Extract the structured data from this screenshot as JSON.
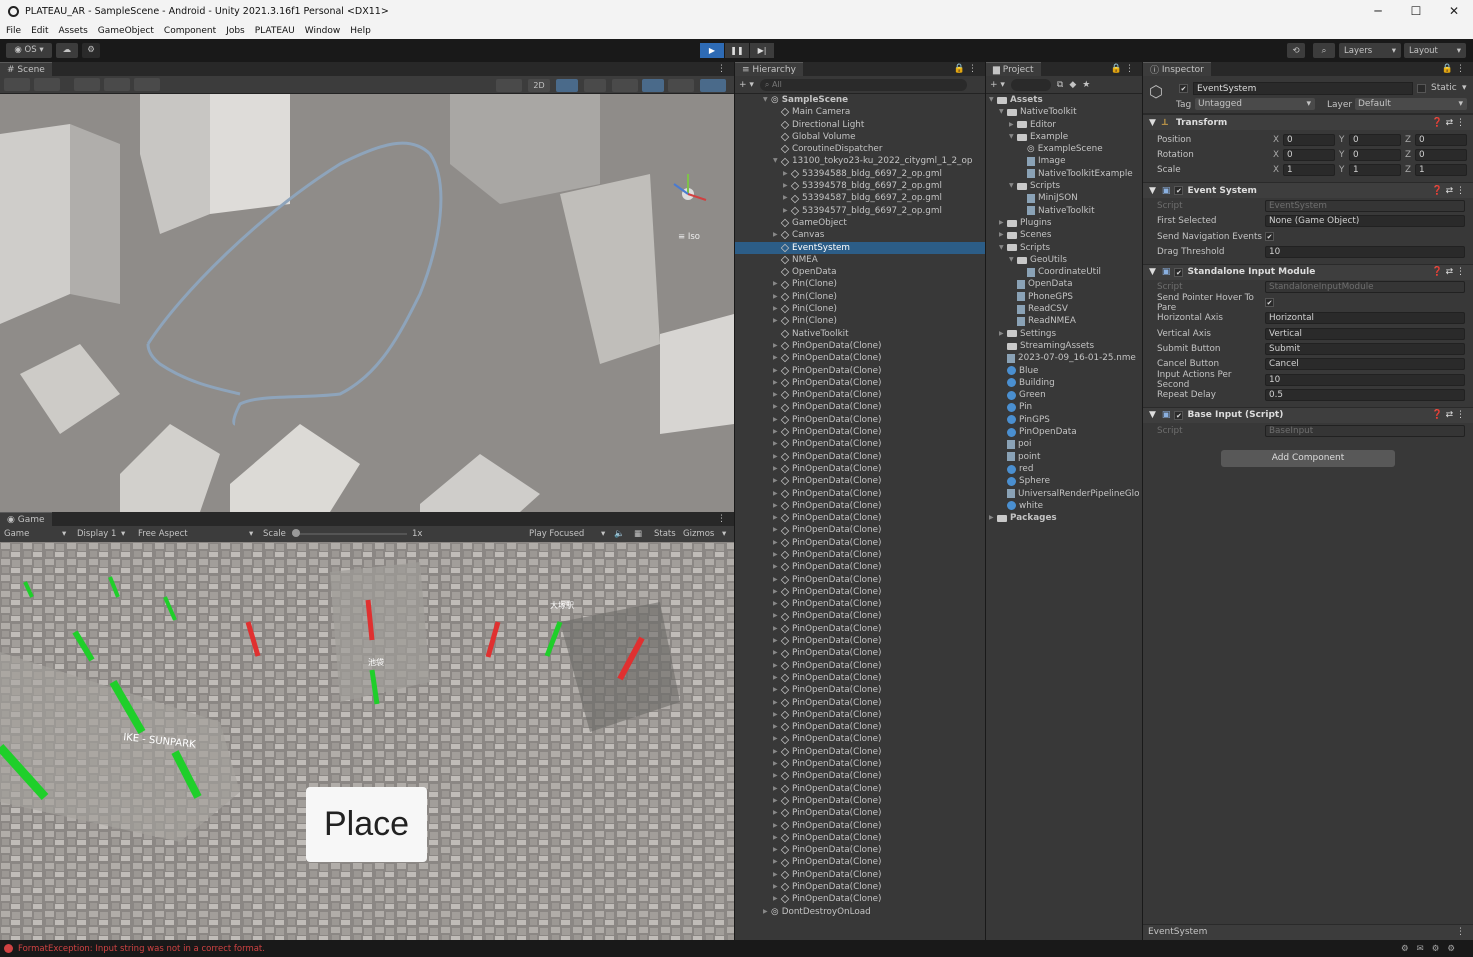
{
  "window": {
    "title": "PLATEAU_AR - SampleScene - Android - Unity 2021.3.16f1 Personal <DX11>",
    "minimize": "─",
    "maximize": "☐",
    "close": "✕"
  },
  "menu": [
    "File",
    "Edit",
    "Assets",
    "GameObject",
    "Component",
    "Jobs",
    "PLATEAU",
    "Window",
    "Help"
  ],
  "toolbar": {
    "account": "OS",
    "layers": "Layers",
    "layout": "Layout"
  },
  "scene": {
    "tab": "Scene",
    "btn2d": "2D",
    "iso": "Iso"
  },
  "game": {
    "tab": "Game",
    "mode": "Game",
    "display": "Display 1",
    "aspect": "Free Aspect",
    "scale_label": "Scale",
    "scale_value": "1x",
    "play_focused": "Play Focused",
    "stats": "Stats",
    "gizmos": "Gizmos",
    "place_button": "Place",
    "place_labels": [
      "IKE - SUNPARK",
      "池袋",
      "大塚駅"
    ]
  },
  "hierarchy": {
    "tab": "Hierarchy",
    "search": "All",
    "items": [
      {
        "label": "SampleScene",
        "indent": 0,
        "fold": "▼",
        "icon": "unity",
        "bold": true
      },
      {
        "label": "Main Camera",
        "indent": 1,
        "icon": "cube"
      },
      {
        "label": "Directional Light",
        "indent": 1,
        "icon": "cube"
      },
      {
        "label": "Global Volume",
        "indent": 1,
        "icon": "cube"
      },
      {
        "label": "CoroutineDispatcher",
        "indent": 1,
        "icon": "cube"
      },
      {
        "label": "13100_tokyo23-ku_2022_citygml_1_2_op",
        "indent": 1,
        "fold": "▼",
        "icon": "cube"
      },
      {
        "label": "53394588_bldg_6697_2_op.gml",
        "indent": 2,
        "fold": "▶",
        "icon": "cube"
      },
      {
        "label": "53394578_bldg_6697_2_op.gml",
        "indent": 2,
        "fold": "▶",
        "icon": "cube"
      },
      {
        "label": "53394587_bldg_6697_2_op.gml",
        "indent": 2,
        "fold": "▶",
        "icon": "cube"
      },
      {
        "label": "53394577_bldg_6697_2_op.gml",
        "indent": 2,
        "fold": "▶",
        "icon": "cube"
      },
      {
        "label": "GameObject",
        "indent": 1,
        "icon": "cube"
      },
      {
        "label": "Canvas",
        "indent": 1,
        "fold": "▶",
        "icon": "cube"
      },
      {
        "label": "EventSystem",
        "indent": 1,
        "icon": "cube",
        "selected": true
      },
      {
        "label": "NMEA",
        "indent": 1,
        "icon": "cube"
      },
      {
        "label": "OpenData",
        "indent": 1,
        "icon": "cube"
      },
      {
        "label": "Pin(Clone)",
        "indent": 1,
        "fold": "▶",
        "icon": "cube"
      },
      {
        "label": "Pin(Clone)",
        "indent": 1,
        "fold": "▶",
        "icon": "cube"
      },
      {
        "label": "Pin(Clone)",
        "indent": 1,
        "fold": "▶",
        "icon": "cube"
      },
      {
        "label": "Pin(Clone)",
        "indent": 1,
        "fold": "▶",
        "icon": "cube"
      },
      {
        "label": "NativeToolkit",
        "indent": 1,
        "icon": "cube"
      },
      {
        "label": "PinOpenData(Clone)",
        "indent": 1,
        "fold": "▶",
        "icon": "cube"
      },
      {
        "label": "PinOpenData(Clone)",
        "indent": 1,
        "fold": "▶",
        "icon": "cube"
      },
      {
        "label": "PinOpenData(Clone)",
        "indent": 1,
        "fold": "▶",
        "icon": "cube"
      },
      {
        "label": "PinOpenData(Clone)",
        "indent": 1,
        "fold": "▶",
        "icon": "cube"
      },
      {
        "label": "PinOpenData(Clone)",
        "indent": 1,
        "fold": "▶",
        "icon": "cube"
      },
      {
        "label": "PinOpenData(Clone)",
        "indent": 1,
        "fold": "▶",
        "icon": "cube"
      },
      {
        "label": "PinOpenData(Clone)",
        "indent": 1,
        "fold": "▶",
        "icon": "cube"
      },
      {
        "label": "PinOpenData(Clone)",
        "indent": 1,
        "fold": "▶",
        "icon": "cube"
      },
      {
        "label": "PinOpenData(Clone)",
        "indent": 1,
        "fold": "▶",
        "icon": "cube"
      },
      {
        "label": "PinOpenData(Clone)",
        "indent": 1,
        "fold": "▶",
        "icon": "cube"
      },
      {
        "label": "PinOpenData(Clone)",
        "indent": 1,
        "fold": "▶",
        "icon": "cube"
      },
      {
        "label": "PinOpenData(Clone)",
        "indent": 1,
        "fold": "▶",
        "icon": "cube"
      },
      {
        "label": "PinOpenData(Clone)",
        "indent": 1,
        "fold": "▶",
        "icon": "cube"
      },
      {
        "label": "PinOpenData(Clone)",
        "indent": 1,
        "fold": "▶",
        "icon": "cube"
      },
      {
        "label": "PinOpenData(Clone)",
        "indent": 1,
        "fold": "▶",
        "icon": "cube"
      },
      {
        "label": "PinOpenData(Clone)",
        "indent": 1,
        "fold": "▶",
        "icon": "cube"
      },
      {
        "label": "PinOpenData(Clone)",
        "indent": 1,
        "fold": "▶",
        "icon": "cube"
      },
      {
        "label": "PinOpenData(Clone)",
        "indent": 1,
        "fold": "▶",
        "icon": "cube"
      },
      {
        "label": "PinOpenData(Clone)",
        "indent": 1,
        "fold": "▶",
        "icon": "cube"
      },
      {
        "label": "PinOpenData(Clone)",
        "indent": 1,
        "fold": "▶",
        "icon": "cube"
      },
      {
        "label": "PinOpenData(Clone)",
        "indent": 1,
        "fold": "▶",
        "icon": "cube"
      },
      {
        "label": "PinOpenData(Clone)",
        "indent": 1,
        "fold": "▶",
        "icon": "cube"
      },
      {
        "label": "PinOpenData(Clone)",
        "indent": 1,
        "fold": "▶",
        "icon": "cube"
      },
      {
        "label": "PinOpenData(Clone)",
        "indent": 1,
        "fold": "▶",
        "icon": "cube"
      },
      {
        "label": "PinOpenData(Clone)",
        "indent": 1,
        "fold": "▶",
        "icon": "cube"
      },
      {
        "label": "PinOpenData(Clone)",
        "indent": 1,
        "fold": "▶",
        "icon": "cube"
      },
      {
        "label": "PinOpenData(Clone)",
        "indent": 1,
        "fold": "▶",
        "icon": "cube"
      },
      {
        "label": "PinOpenData(Clone)",
        "indent": 1,
        "fold": "▶",
        "icon": "cube"
      },
      {
        "label": "PinOpenData(Clone)",
        "indent": 1,
        "fold": "▶",
        "icon": "cube"
      },
      {
        "label": "PinOpenData(Clone)",
        "indent": 1,
        "fold": "▶",
        "icon": "cube"
      },
      {
        "label": "PinOpenData(Clone)",
        "indent": 1,
        "fold": "▶",
        "icon": "cube"
      },
      {
        "label": "PinOpenData(Clone)",
        "indent": 1,
        "fold": "▶",
        "icon": "cube"
      },
      {
        "label": "PinOpenData(Clone)",
        "indent": 1,
        "fold": "▶",
        "icon": "cube"
      },
      {
        "label": "PinOpenData(Clone)",
        "indent": 1,
        "fold": "▶",
        "icon": "cube"
      },
      {
        "label": "PinOpenData(Clone)",
        "indent": 1,
        "fold": "▶",
        "icon": "cube"
      },
      {
        "label": "PinOpenData(Clone)",
        "indent": 1,
        "fold": "▶",
        "icon": "cube"
      },
      {
        "label": "PinOpenData(Clone)",
        "indent": 1,
        "fold": "▶",
        "icon": "cube"
      },
      {
        "label": "PinOpenData(Clone)",
        "indent": 1,
        "fold": "▶",
        "icon": "cube"
      },
      {
        "label": "PinOpenData(Clone)",
        "indent": 1,
        "fold": "▶",
        "icon": "cube"
      },
      {
        "label": "PinOpenData(Clone)",
        "indent": 1,
        "fold": "▶",
        "icon": "cube"
      },
      {
        "label": "PinOpenData(Clone)",
        "indent": 1,
        "fold": "▶",
        "icon": "cube"
      },
      {
        "label": "PinOpenData(Clone)",
        "indent": 1,
        "fold": "▶",
        "icon": "cube"
      },
      {
        "label": "PinOpenData(Clone)",
        "indent": 1,
        "fold": "▶",
        "icon": "cube"
      },
      {
        "label": "PinOpenData(Clone)",
        "indent": 1,
        "fold": "▶",
        "icon": "cube"
      },
      {
        "label": "PinOpenData(Clone)",
        "indent": 1,
        "fold": "▶",
        "icon": "cube"
      },
      {
        "label": "PinOpenData(Clone)",
        "indent": 1,
        "fold": "▶",
        "icon": "cube"
      },
      {
        "label": "DontDestroyOnLoad",
        "indent": 0,
        "fold": "▶",
        "icon": "unity"
      }
    ]
  },
  "project": {
    "tab": "Project",
    "items": [
      {
        "label": "Assets",
        "indent": 0,
        "fold": "▼",
        "icon": "folder",
        "bold": true
      },
      {
        "label": "NativeToolkit",
        "indent": 1,
        "fold": "▼",
        "icon": "folder"
      },
      {
        "label": "Editor",
        "indent": 2,
        "fold": "▶",
        "icon": "folder"
      },
      {
        "label": "Example",
        "indent": 2,
        "fold": "▼",
        "icon": "folder"
      },
      {
        "label": "ExampleScene",
        "indent": 3,
        "icon": "unity"
      },
      {
        "label": "Image",
        "indent": 3,
        "icon": "script"
      },
      {
        "label": "NativeToolkitExample",
        "indent": 3,
        "icon": "script"
      },
      {
        "label": "Scripts",
        "indent": 2,
        "fold": "▼",
        "icon": "folder"
      },
      {
        "label": "MiniJSON",
        "indent": 3,
        "icon": "script"
      },
      {
        "label": "NativeToolkit",
        "indent": 3,
        "icon": "script"
      },
      {
        "label": "Plugins",
        "indent": 1,
        "fold": "▶",
        "icon": "folder"
      },
      {
        "label": "Scenes",
        "indent": 1,
        "fold": "▶",
        "icon": "folder"
      },
      {
        "label": "Scripts",
        "indent": 1,
        "fold": "▼",
        "icon": "folder"
      },
      {
        "label": "GeoUtils",
        "indent": 2,
        "fold": "▼",
        "icon": "folder"
      },
      {
        "label": "CoordinateUtil",
        "indent": 3,
        "icon": "script"
      },
      {
        "label": "OpenData",
        "indent": 2,
        "icon": "script"
      },
      {
        "label": "PhoneGPS",
        "indent": 2,
        "icon": "script"
      },
      {
        "label": "ReadCSV",
        "indent": 2,
        "icon": "script"
      },
      {
        "label": "ReadNMEA",
        "indent": 2,
        "icon": "script"
      },
      {
        "label": "Settings",
        "indent": 1,
        "fold": "▶",
        "icon": "folder"
      },
      {
        "label": "StreamingAssets",
        "indent": 1,
        "icon": "folder"
      },
      {
        "label": "2023-07-09_16-01-25.nme",
        "indent": 1,
        "icon": "script"
      },
      {
        "label": "Blue",
        "indent": 1,
        "icon": "mat"
      },
      {
        "label": "Building",
        "indent": 1,
        "icon": "mat"
      },
      {
        "label": "Green",
        "indent": 1,
        "icon": "mat"
      },
      {
        "label": "Pin",
        "indent": 1,
        "icon": "mat"
      },
      {
        "label": "PinGPS",
        "indent": 1,
        "icon": "mat"
      },
      {
        "label": "PinOpenData",
        "indent": 1,
        "icon": "mat"
      },
      {
        "label": "poi",
        "indent": 1,
        "icon": "script"
      },
      {
        "label": "point",
        "indent": 1,
        "icon": "script"
      },
      {
        "label": "red",
        "indent": 1,
        "icon": "mat"
      },
      {
        "label": "Sphere",
        "indent": 1,
        "icon": "mat"
      },
      {
        "label": "UniversalRenderPipelineGlo",
        "indent": 1,
        "icon": "script"
      },
      {
        "label": "white",
        "indent": 1,
        "icon": "mat"
      },
      {
        "label": "Packages",
        "indent": 0,
        "fold": "▶",
        "icon": "folder",
        "bold": true
      }
    ]
  },
  "inspector": {
    "tab": "Inspector",
    "object_name": "EventSystem",
    "static_label": "Static",
    "tag_label": "Tag",
    "tag_value": "Untagged",
    "layer_label": "Layer",
    "layer_value": "Default",
    "transform": {
      "title": "Transform",
      "rows": [
        {
          "label": "Position",
          "x": "0",
          "y": "0",
          "z": "0"
        },
        {
          "label": "Rotation",
          "x": "0",
          "y": "0",
          "z": "0"
        },
        {
          "label": "Scale",
          "x": "1",
          "y": "1",
          "z": "1"
        }
      ]
    },
    "components": [
      {
        "title": "Event System",
        "rows": [
          {
            "label": "Script",
            "value": "EventSystem",
            "disabled": true
          },
          {
            "label": "First Selected",
            "value": "None (Game Object)"
          },
          {
            "label": "Send Navigation Events",
            "value": "✔",
            "check": true
          },
          {
            "label": "Drag Threshold",
            "value": "10"
          }
        ]
      },
      {
        "title": "Standalone Input Module",
        "rows": [
          {
            "label": "Script",
            "value": "StandaloneInputModule",
            "disabled": true
          },
          {
            "label": "Send Pointer Hover To Pare",
            "value": "✔",
            "check": true
          },
          {
            "label": "Horizontal Axis",
            "value": "Horizontal"
          },
          {
            "label": "Vertical Axis",
            "value": "Vertical"
          },
          {
            "label": "Submit Button",
            "value": "Submit"
          },
          {
            "label": "Cancel Button",
            "value": "Cancel"
          },
          {
            "label": "Input Actions Per Second",
            "value": "10"
          },
          {
            "label": "Repeat Delay",
            "value": "0.5"
          }
        ]
      },
      {
        "title": "Base Input (Script)",
        "rows": [
          {
            "label": "Script",
            "value": "BaseInput",
            "disabled": true
          }
        ]
      }
    ],
    "add_component": "Add Component",
    "footer": "EventSystem"
  },
  "status": {
    "error": "FormatException: Input string was not in a correct format."
  }
}
